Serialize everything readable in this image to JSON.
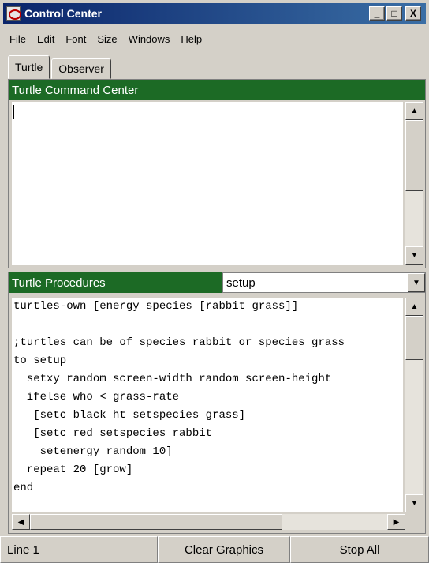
{
  "window": {
    "title": "Control Center",
    "minimize_glyph": "_",
    "maximize_glyph": "□",
    "close_glyph": "X"
  },
  "menu": [
    "File",
    "Edit",
    "Font",
    "Size",
    "Windows",
    "Help"
  ],
  "tabs": [
    {
      "label": "Turtle"
    },
    {
      "label": "Observer"
    }
  ],
  "command_center": {
    "title": "Turtle Command Center",
    "input_value": ""
  },
  "procedures": {
    "title": "Turtle Procedures",
    "selected": "setup",
    "code": [
      "turtles-own [energy species [rabbit grass]]",
      "",
      ";turtles can be of species rabbit or species grass",
      "to setup",
      "  setxy random screen-width random screen-height",
      "  ifelse who < grass-rate",
      "   [setc black ht setspecies grass]",
      "   [setc red setspecies rabbit",
      "    setenergy random 10]",
      "  repeat 20 [grow]",
      "end"
    ]
  },
  "status": {
    "line": "Line 1",
    "clear_graphics": "Clear Graphics",
    "stop_all": "Stop All"
  },
  "colors": {
    "header_green": "#1c6a25",
    "title_blue": "#0a246a"
  },
  "icons": {
    "app": "control-center-app-icon",
    "scroll_up": "▲",
    "scroll_down": "▼",
    "scroll_left": "◀",
    "scroll_right": "▶",
    "dropdown": "▼"
  }
}
